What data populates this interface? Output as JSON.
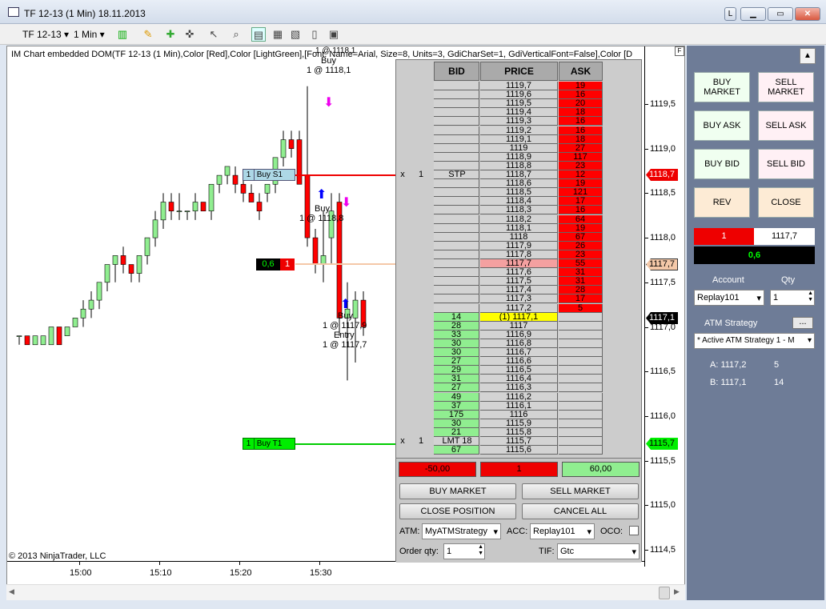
{
  "window": {
    "title": "TF 12-13 (1 Min)  18.11.2013"
  },
  "toolbar": {
    "instrument": "TF 12-13",
    "interval": "1 Min"
  },
  "chart": {
    "header_text": "IM Chart embedded DOM(TF 12-13 (1 Min),Color [Red],Color [LightGreen],[Font: Name=Arial, Size=8, Units=3, GdiCharSet=1, GdiVerticalFont=False],Color [D",
    "copyright": "© 2013 NinjaTrader, LLC",
    "price_axis": [
      "1119,5",
      "1119,0",
      "1118,5",
      "1118,0",
      "1117,5",
      "1117,0",
      "1116,5",
      "1116,0",
      "1115,5",
      "1115,0",
      "1114,5"
    ],
    "time_axis": [
      "15:00",
      "15:10",
      "15:20",
      "15:30"
    ],
    "annotations": {
      "buy_top": "Buy",
      "buy_top_qty": "1 @ 1118,1",
      "buy_top_cut": "1 @ 1118,1",
      "buy_mid": "Buy",
      "buy_mid_qty": "1 @ 1118,8",
      "buy_low": "Buy",
      "buy_low_qty": "1 @ 1117,9",
      "entry": "Entry",
      "entry_qty": "1 @ 1117,7"
    },
    "stop_tag": {
      "qty": "1",
      "label": "Buy S1",
      "price": "1118,7"
    },
    "target_tag": {
      "qty": "1",
      "label": "Buy T1",
      "price": "1115,7"
    },
    "position_tag": {
      "pnl": "0,6",
      "qty": "1",
      "price": "1117,7"
    },
    "last_price": "1117,1",
    "colors": {
      "up": "#90ee90",
      "down": "#ff0000"
    }
  },
  "dom": {
    "headers": {
      "bid": "BID",
      "price": "PRICE",
      "ask": "ASK"
    },
    "rows": [
      {
        "bid": "",
        "price": "1119,7",
        "ask": "19"
      },
      {
        "bid": "",
        "price": "1119,6",
        "ask": "16"
      },
      {
        "bid": "",
        "price": "1119,5",
        "ask": "20"
      },
      {
        "bid": "",
        "price": "1119,4",
        "ask": "18"
      },
      {
        "bid": "",
        "price": "1119,3",
        "ask": "16"
      },
      {
        "bid": "",
        "price": "1119,2",
        "ask": "16"
      },
      {
        "bid": "",
        "price": "1119,1",
        "ask": "18"
      },
      {
        "bid": "",
        "price": "1119",
        "ask": "27"
      },
      {
        "bid": "",
        "price": "1118,9",
        "ask": "117"
      },
      {
        "bid": "",
        "price": "1118,8",
        "ask": "23"
      },
      {
        "bid": "",
        "price": "1118,7",
        "ask": "12",
        "stop": "STP",
        "x": "x",
        "q": "1"
      },
      {
        "bid": "",
        "price": "1118,6",
        "ask": "19"
      },
      {
        "bid": "",
        "price": "1118,5",
        "ask": "121"
      },
      {
        "bid": "",
        "price": "1118,4",
        "ask": "17"
      },
      {
        "bid": "",
        "price": "1118,3",
        "ask": "16"
      },
      {
        "bid": "",
        "price": "1118,2",
        "ask": "64"
      },
      {
        "bid": "",
        "price": "1118,1",
        "ask": "19"
      },
      {
        "bid": "",
        "price": "1118",
        "ask": "67"
      },
      {
        "bid": "",
        "price": "1117,9",
        "ask": "26"
      },
      {
        "bid": "",
        "price": "1117,8",
        "ask": "23"
      },
      {
        "bid": "",
        "price": "1117,7",
        "ask": "55",
        "pos": true
      },
      {
        "bid": "",
        "price": "1117,6",
        "ask": "31"
      },
      {
        "bid": "",
        "price": "1117,5",
        "ask": "31"
      },
      {
        "bid": "",
        "price": "1117,4",
        "ask": "28"
      },
      {
        "bid": "",
        "price": "1117,3",
        "ask": "17"
      },
      {
        "bid": "",
        "price": "1117,2",
        "ask": "5"
      },
      {
        "bid": "14",
        "price": "(1) 1117,1",
        "ask": "",
        "last": true
      },
      {
        "bid": "28",
        "price": "1117",
        "ask": ""
      },
      {
        "bid": "33",
        "price": "1116,9",
        "ask": ""
      },
      {
        "bid": "30",
        "price": "1116,8",
        "ask": ""
      },
      {
        "bid": "30",
        "price": "1116,7",
        "ask": ""
      },
      {
        "bid": "27",
        "price": "1116,6",
        "ask": ""
      },
      {
        "bid": "29",
        "price": "1116,5",
        "ask": ""
      },
      {
        "bid": "31",
        "price": "1116,4",
        "ask": ""
      },
      {
        "bid": "27",
        "price": "1116,3",
        "ask": ""
      },
      {
        "bid": "49",
        "price": "1116,2",
        "ask": ""
      },
      {
        "bid": "37",
        "price": "1116,1",
        "ask": ""
      },
      {
        "bid": "175",
        "price": "1116",
        "ask": ""
      },
      {
        "bid": "30",
        "price": "1115,9",
        "ask": ""
      },
      {
        "bid": "21",
        "price": "1115,8",
        "ask": ""
      },
      {
        "bid": "",
        "price": "1115,7",
        "ask": "",
        "stop": "LMT 18",
        "x": "x",
        "q": "1"
      },
      {
        "bid": "67",
        "price": "1115,6",
        "ask": ""
      }
    ],
    "summary": {
      "left": "-50,00",
      "mid": "1",
      "right": "60,00"
    },
    "buttons": {
      "buy_market": "BUY MARKET",
      "sell_market": "SELL MARKET",
      "close_position": "CLOSE POSITION",
      "cancel_all": "CANCEL ALL"
    },
    "atm_label": "ATM:",
    "atm_value": "MyATMStrategy",
    "acc_label": "ACC:",
    "acc_value": "Replay101",
    "oco_label": "OCO:",
    "qty_label": "Order qty:",
    "qty_value": "1",
    "tif_label": "TIF:",
    "tif_value": "Gtc"
  },
  "panel": {
    "buy_market": "BUY MARKET",
    "sell_market": "SELL MARKET",
    "buy_ask": "BUY ASK",
    "sell_ask": "SELL ASK",
    "buy_bid": "BUY BID",
    "sell_bid": "SELL BID",
    "rev": "REV",
    "close": "CLOSE",
    "pos_qty": "1",
    "pos_price": "1117,7",
    "pnl": "0,6",
    "account_label": "Account",
    "qty_label": "Qty",
    "account_value": "Replay101",
    "qty_value": "1",
    "atm_label": "ATM Strategy",
    "atm_btn": "...",
    "atm_value": "* Active ATM Strategy 1 - M",
    "ask_label": "A: 1117,2",
    "ask_size": "5",
    "bid_label": "B: 1117,1",
    "bid_size": "14"
  }
}
